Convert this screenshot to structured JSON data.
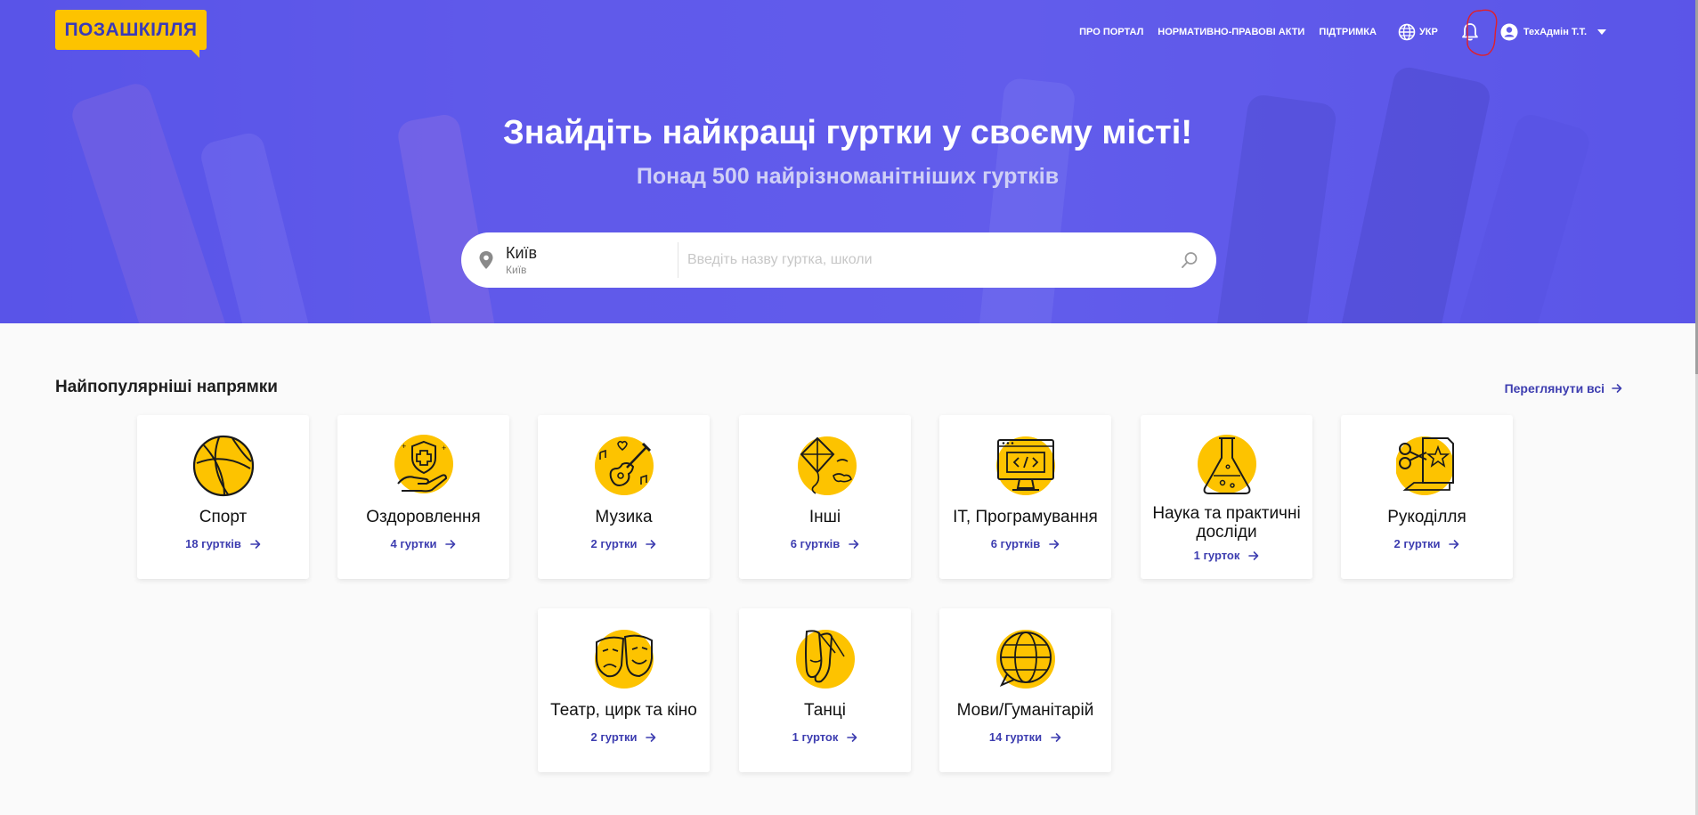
{
  "brand": {
    "logo_text": "ПОЗАШКІЛЛЯ"
  },
  "nav": {
    "links": [
      "Про портал",
      "Нормативно-правові акти",
      "Підтримка"
    ],
    "language": "УКР",
    "user_name": "ТехАдмін Т.Т."
  },
  "hero": {
    "title": "Знайдіть найкращі гуртки у своєму місті!",
    "subtitle": "Понад 500 найрізноманітніших гуртків"
  },
  "search": {
    "city": "Київ",
    "city_sub": "Київ",
    "placeholder": "Введіть назву гуртка, школи"
  },
  "directions": {
    "title": "Найпопулярніші напрямки",
    "view_all": "Переглянути всі",
    "cards": [
      {
        "title": "Спорт",
        "count": "18 гуртків",
        "icon": "basketball-icon"
      },
      {
        "title": "Оздоровлення",
        "count": "4 гуртки",
        "icon": "health-hand-icon"
      },
      {
        "title": "Музика",
        "count": "2 гуртки",
        "icon": "guitar-icon"
      },
      {
        "title": "Інші",
        "count": "6 гуртків",
        "icon": "kite-icon"
      },
      {
        "title": "ІТ, Програмування",
        "count": "6 гуртків",
        "icon": "computer-code-icon"
      },
      {
        "title": "Наука та практичні досліди",
        "count": "1 гурток",
        "icon": "flask-icon"
      },
      {
        "title": "Рукоділля",
        "count": "2 гуртки",
        "icon": "scissors-paper-icon"
      },
      {
        "title": "Театр, цирк та кіно",
        "count": "2 гуртки",
        "icon": "theatre-masks-icon"
      },
      {
        "title": "Танці",
        "count": "1 гурток",
        "icon": "ballet-shoes-icon"
      },
      {
        "title": "Мови/Гуманітарій",
        "count": "14 гуртки",
        "icon": "globe-chat-icon"
      }
    ]
  },
  "colors": {
    "accent": "#3d3db0",
    "brand_yellow": "#fdc300",
    "hero_bg": "#5f5ae8"
  }
}
